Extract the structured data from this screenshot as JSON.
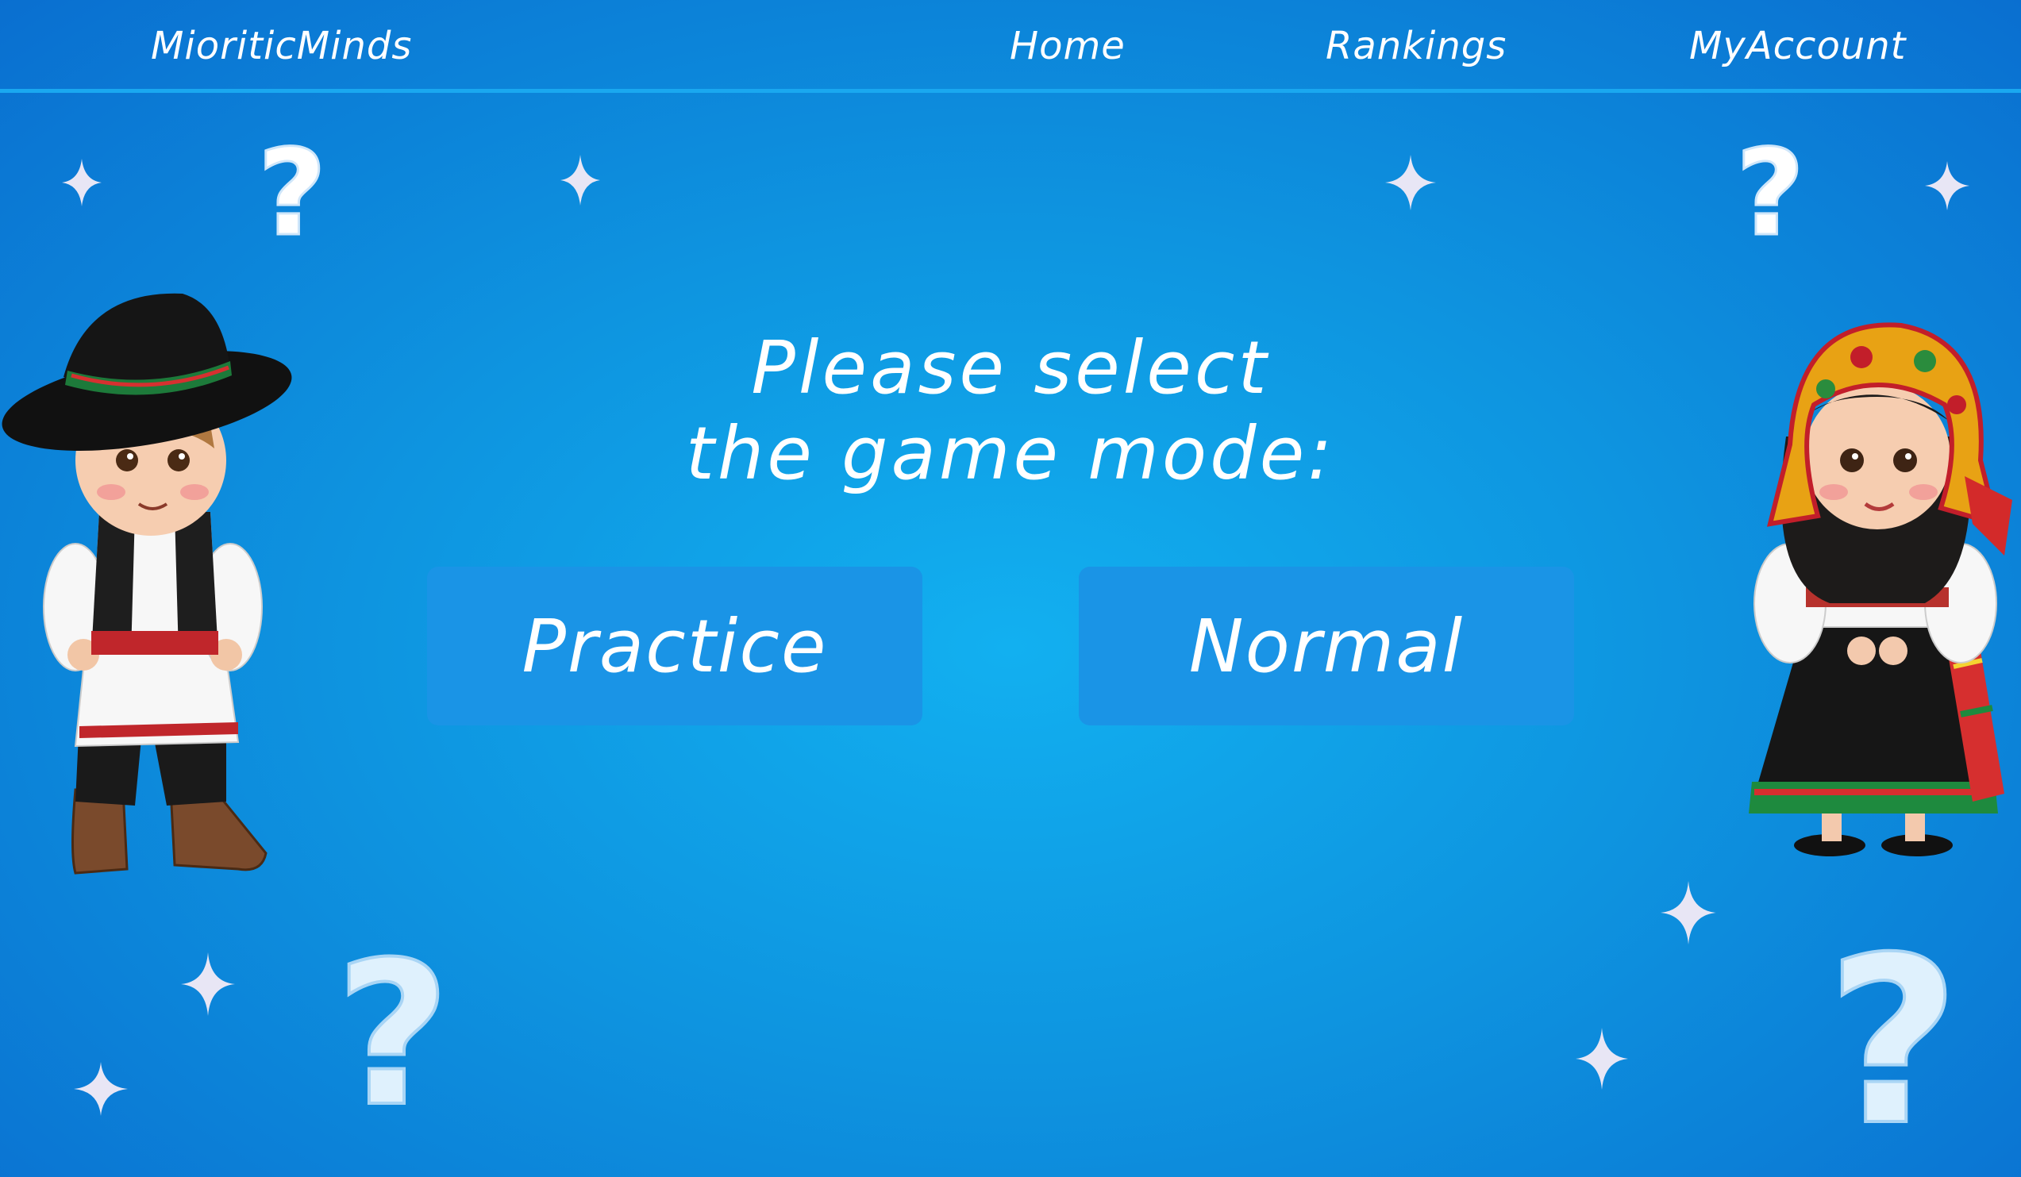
{
  "nav": {
    "brand": "MioriticMinds",
    "home": "Home",
    "rankings": "Rankings",
    "account": "MyAccount"
  },
  "main": {
    "title_line1": "Please select",
    "title_line2": "the game mode:",
    "modes": [
      {
        "label": "Practice"
      },
      {
        "label": "Normal"
      }
    ]
  },
  "decor": {
    "question_mark": "?",
    "characters": [
      "boy-folk-costume",
      "girl-folk-costume"
    ]
  },
  "colors": {
    "background": "#0e95e0",
    "button": "#1a94e6",
    "text": "#ffffff"
  }
}
